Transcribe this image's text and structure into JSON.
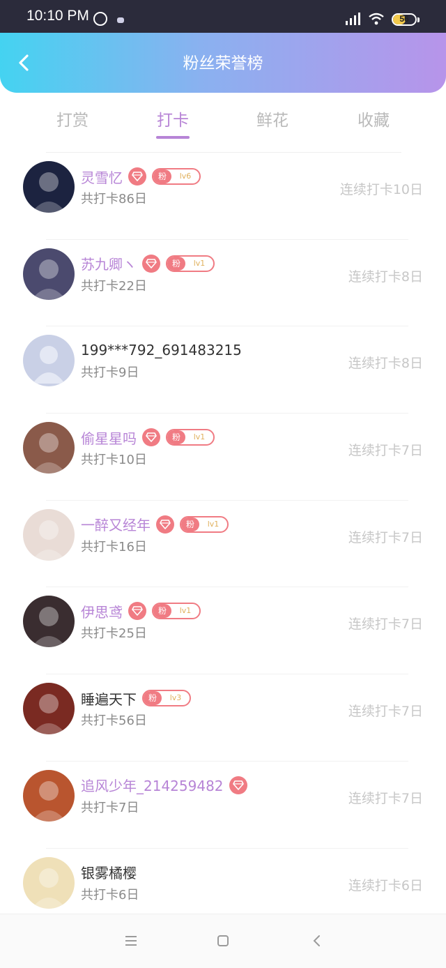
{
  "status_bar": {
    "time": "10:10 PM",
    "battery_level": "56",
    "battery_fraction": 0.56
  },
  "header": {
    "title": "粉丝荣誉榜",
    "back_icon": "chevron-left-icon"
  },
  "tabs": [
    {
      "label": "打赏",
      "active": false
    },
    {
      "label": "打卡",
      "active": true
    },
    {
      "label": "鲜花",
      "active": false
    },
    {
      "label": "收藏",
      "active": false
    }
  ],
  "fans": [
    {
      "name": "灵雪忆",
      "vip": true,
      "fan_level": "lv6",
      "total": "共打卡86日",
      "streak": "连续打卡10日",
      "avatar_color": "#1c2340"
    },
    {
      "name": "苏九卿ヽ",
      "vip": true,
      "fan_level": "lv1",
      "total": "共打卡22日",
      "streak": "连续打卡8日",
      "avatar_color": "#4b4a6e"
    },
    {
      "name": "199***792_691483215",
      "vip": false,
      "fan_level": "",
      "total": "共打卡9日",
      "streak": "连续打卡8日",
      "avatar_color": "#c9d0e6"
    },
    {
      "name": "偷星星吗",
      "vip": true,
      "fan_level": "lv1",
      "total": "共打卡10日",
      "streak": "连续打卡7日",
      "avatar_color": "#8a5a4a"
    },
    {
      "name": "一醉又经年",
      "vip": true,
      "fan_level": "lv1",
      "total": "共打卡16日",
      "streak": "连续打卡7日",
      "avatar_color": "#e9dcd6"
    },
    {
      "name": "伊思鸢",
      "vip": true,
      "fan_level": "lv1",
      "total": "共打卡25日",
      "streak": "连续打卡7日",
      "avatar_color": "#3a2d30"
    },
    {
      "name": "睡遍天下",
      "vip": false,
      "fan_level": "lv3",
      "total": "共打卡56日",
      "streak": "连续打卡7日",
      "avatar_color": "#7a2a22"
    },
    {
      "name": "追风少年_214259482",
      "vip": true,
      "fan_level": "",
      "total": "共打卡7日",
      "streak": "连续打卡7日",
      "avatar_color": "#b9552f"
    },
    {
      "name": "银雾橘樱",
      "vip": false,
      "fan_level": "",
      "total": "共打卡6日",
      "streak": "连续打卡6日",
      "avatar_color": "#efe0b8"
    }
  ],
  "fan_badge_text": "粉",
  "navbar": {
    "menu_icon": "menu-icon",
    "home_icon": "square-home-icon",
    "back_icon": "triangle-back-icon"
  },
  "colors": {
    "accent": "#b784d6",
    "badge": "#f07b83",
    "header_gradient_start": "#44d3f1",
    "header_gradient_end": "#b794ea"
  }
}
